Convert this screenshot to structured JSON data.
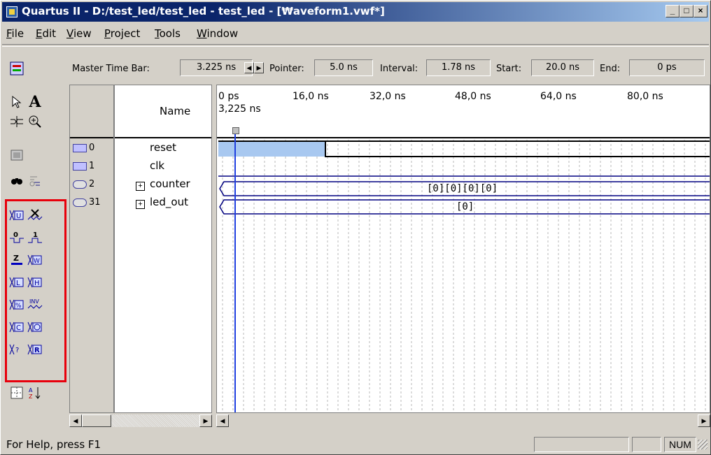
{
  "window": {
    "title": "Quartus II - D:/test_led/test_led - test_led - [₩aveform1.vwf*]",
    "controls": {
      "minimize": "_",
      "maximize": "□",
      "close": "×"
    }
  },
  "menubar": {
    "items": [
      {
        "label": "File",
        "u": "F",
        "rest": "ile"
      },
      {
        "label": "Edit",
        "u": "E",
        "rest": "dit"
      },
      {
        "label": "View",
        "u": "V",
        "rest": "iew"
      },
      {
        "label": "Project",
        "u": "P",
        "rest": "roject"
      },
      {
        "label": "Tools",
        "u": "T",
        "rest": "ools"
      },
      {
        "label": "Window",
        "u": "W",
        "rest": "indow"
      }
    ]
  },
  "timebar": {
    "master_label": "Master Time Bar:",
    "master_value": "3.225 ns",
    "pointer_label": "Pointer:",
    "pointer_value": "5.0 ns",
    "interval_label": "Interval:",
    "interval_value": "1.78 ns",
    "start_label": "Start:",
    "start_value": "20.0 ns",
    "end_label": "End:",
    "end_value": "0 ps"
  },
  "columns": {
    "name_header": "Name"
  },
  "ruler": {
    "ticks": [
      "0 ps",
      "16,0 ns",
      "32,0 ns",
      "48,0 ns",
      "64,0 ns",
      "80,0 ns"
    ],
    "cursor_label": "3,225 ns"
  },
  "signals": [
    {
      "index": "0",
      "name": "reset",
      "expandable": false
    },
    {
      "index": "1",
      "name": "clk",
      "expandable": false
    },
    {
      "index": "2",
      "name": "counter",
      "expandable": true,
      "value": "[0][0][0][0]"
    },
    {
      "index": "31",
      "name": "led_out",
      "expandable": true,
      "value": "[0]"
    }
  ],
  "tools": {
    "icons": [
      "waveform-editor-icon",
      "selection-tool-icon",
      "text-tool-icon",
      "waveform-editing-tool-icon",
      "zoom-tool-icon",
      "full-screen-icon",
      "find-icon",
      "replace-icon",
      "uninitialized-icon",
      "forcing-unknown-icon",
      "forcing-low-icon",
      "forcing-high-icon",
      "high-impedance-icon",
      "weak-unknown-icon",
      "weak-low-icon",
      "weak-high-icon",
      "invert-icon",
      "count-value-icon",
      "overwrite-clock-icon",
      "overwrite-arbitrary-icon",
      "random-values-icon",
      "sort-icon",
      "snap-grid-icon"
    ],
    "highlight_color": "#e8000c"
  },
  "statusbar": {
    "help_text": "For Help, press F1",
    "num_indicator": "NUM"
  }
}
